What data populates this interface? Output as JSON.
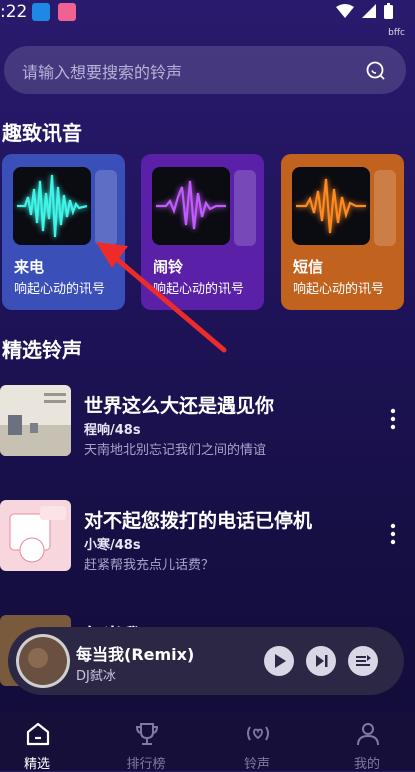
{
  "status": {
    "time": ":22",
    "extra": "bffc"
  },
  "search": {
    "placeholder": "请输入想要搜索的铃声"
  },
  "sections": {
    "featured_title": "趣致讯音",
    "list_title": "精选铃声"
  },
  "cards": [
    {
      "title": "来电",
      "subtitle": "响起心动的讯号",
      "color": "#3a4fb8",
      "wave_color": "#3ff5e8"
    },
    {
      "title": "闹铃",
      "subtitle": "响起心动的讯号",
      "color": "#5a20a8",
      "wave_color": "#c25cff"
    },
    {
      "title": "短信",
      "subtitle": "响起心动的讯号",
      "color": "#c2621f",
      "wave_color": "#ff8a1f"
    }
  ],
  "songs": [
    {
      "name": "世界这么大还是遇见你",
      "artist": "程响/48s",
      "desc": "天南地北别忘记我们之间的情谊"
    },
    {
      "name": "对不起您拨打的电话已停机",
      "artist": "小寒/48s",
      "desc": "赶紧帮我充点儿话费？"
    },
    {
      "name": "每当我(Remix)",
      "artist": "",
      "desc": ""
    }
  ],
  "player": {
    "title": "每当我(Remix)",
    "artist": "DJ弑冰"
  },
  "tabs": [
    {
      "label": "精选",
      "icon": "home-icon"
    },
    {
      "label": "排行榜",
      "icon": "trophy-icon"
    },
    {
      "label": "铃声",
      "icon": "ringtone-icon"
    },
    {
      "label": "我的",
      "icon": "profile-icon"
    }
  ]
}
